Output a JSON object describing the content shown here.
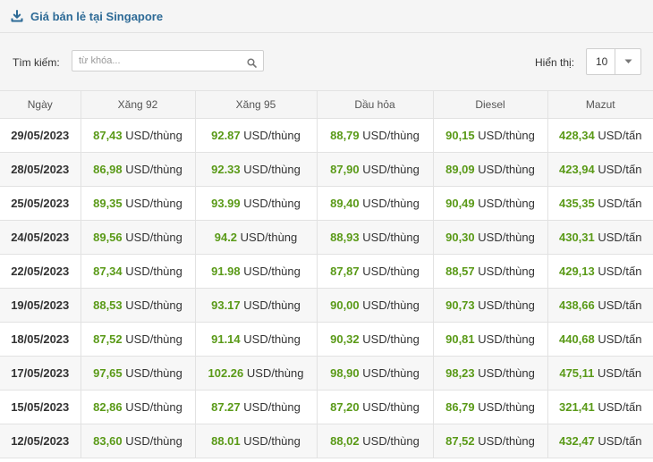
{
  "header": {
    "title": "Giá bán lẻ tại Singapore"
  },
  "toolbar": {
    "search_label": "Tìm kiếm:",
    "search_placeholder": "từ khóa...",
    "search_value": "",
    "page_size_label": "Hiển thị:",
    "page_size_value": "10"
  },
  "colors": {
    "title": "#2d6a96",
    "value_green": "#5a9a18",
    "header_bg": "#f5f5f5"
  },
  "table": {
    "columns": [
      "Ngày",
      "Xăng 92",
      "Xăng 95",
      "Dầu hỏa",
      "Diesel",
      "Mazut"
    ],
    "rows": [
      {
        "date": "29/05/2023",
        "cells": [
          {
            "num": "87,43",
            "unit": "USD/thùng"
          },
          {
            "num": "92.87",
            "unit": "USD/thùng"
          },
          {
            "num": "88,79",
            "unit": "USD/thùng"
          },
          {
            "num": "90,15",
            "unit": "USD/thùng"
          },
          {
            "num": "428,34",
            "unit": "USD/tấn"
          }
        ]
      },
      {
        "date": "28/05/2023",
        "cells": [
          {
            "num": "86,98",
            "unit": "USD/thùng"
          },
          {
            "num": "92.33",
            "unit": "USD/thùng"
          },
          {
            "num": "87,90",
            "unit": "USD/thùng"
          },
          {
            "num": "89,09",
            "unit": "USD/thùng"
          },
          {
            "num": "423,94",
            "unit": "USD/tấn"
          }
        ]
      },
      {
        "date": "25/05/2023",
        "cells": [
          {
            "num": "89,35",
            "unit": "USD/thùng"
          },
          {
            "num": "93.99",
            "unit": "USD/thùng"
          },
          {
            "num": "89,40",
            "unit": "USD/thùng"
          },
          {
            "num": "90,49",
            "unit": "USD/thùng"
          },
          {
            "num": "435,35",
            "unit": "USD/tấn"
          }
        ]
      },
      {
        "date": "24/05/2023",
        "cells": [
          {
            "num": "89,56",
            "unit": "USD/thùng"
          },
          {
            "num": "94.2",
            "unit": "USD/thùng"
          },
          {
            "num": "88,93",
            "unit": "USD/thùng"
          },
          {
            "num": "90,30",
            "unit": "USD/thùng"
          },
          {
            "num": "430,31",
            "unit": "USD/tấn"
          }
        ]
      },
      {
        "date": "22/05/2023",
        "cells": [
          {
            "num": "87,34",
            "unit": "USD/thùng"
          },
          {
            "num": "91.98",
            "unit": "USD/thùng"
          },
          {
            "num": "87,87",
            "unit": "USD/thùng"
          },
          {
            "num": "88,57",
            "unit": "USD/thùng"
          },
          {
            "num": "429,13",
            "unit": "USD/tấn"
          }
        ]
      },
      {
        "date": "19/05/2023",
        "cells": [
          {
            "num": "88,53",
            "unit": "USD/thùng"
          },
          {
            "num": "93.17",
            "unit": "USD/thùng"
          },
          {
            "num": "90,00",
            "unit": "USD/thùng"
          },
          {
            "num": "90,73",
            "unit": "USD/thùng"
          },
          {
            "num": "438,66",
            "unit": "USD/tấn"
          }
        ]
      },
      {
        "date": "18/05/2023",
        "cells": [
          {
            "num": "87,52",
            "unit": "USD/thùng"
          },
          {
            "num": "91.14",
            "unit": "USD/thùng"
          },
          {
            "num": "90,32",
            "unit": "USD/thùng"
          },
          {
            "num": "90,81",
            "unit": "USD/thùng"
          },
          {
            "num": "440,68",
            "unit": "USD/tấn"
          }
        ]
      },
      {
        "date": "17/05/2023",
        "cells": [
          {
            "num": "97,65",
            "unit": "USD/thùng"
          },
          {
            "num": "102.26",
            "unit": "USD/thùng"
          },
          {
            "num": "98,90",
            "unit": "USD/thùng"
          },
          {
            "num": "98,23",
            "unit": "USD/thùng"
          },
          {
            "num": "475,11",
            "unit": "USD/tấn"
          }
        ]
      },
      {
        "date": "15/05/2023",
        "cells": [
          {
            "num": "82,86",
            "unit": "USD/thùng"
          },
          {
            "num": "87.27",
            "unit": "USD/thùng"
          },
          {
            "num": "87,20",
            "unit": "USD/thùng"
          },
          {
            "num": "86,79",
            "unit": "USD/thùng"
          },
          {
            "num": "321,41",
            "unit": "USD/tấn"
          }
        ]
      },
      {
        "date": "12/05/2023",
        "cells": [
          {
            "num": "83,60",
            "unit": "USD/thùng"
          },
          {
            "num": "88.01",
            "unit": "USD/thùng"
          },
          {
            "num": "88,02",
            "unit": "USD/thùng"
          },
          {
            "num": "87,52",
            "unit": "USD/thùng"
          },
          {
            "num": "432,47",
            "unit": "USD/tấn"
          }
        ]
      }
    ]
  }
}
